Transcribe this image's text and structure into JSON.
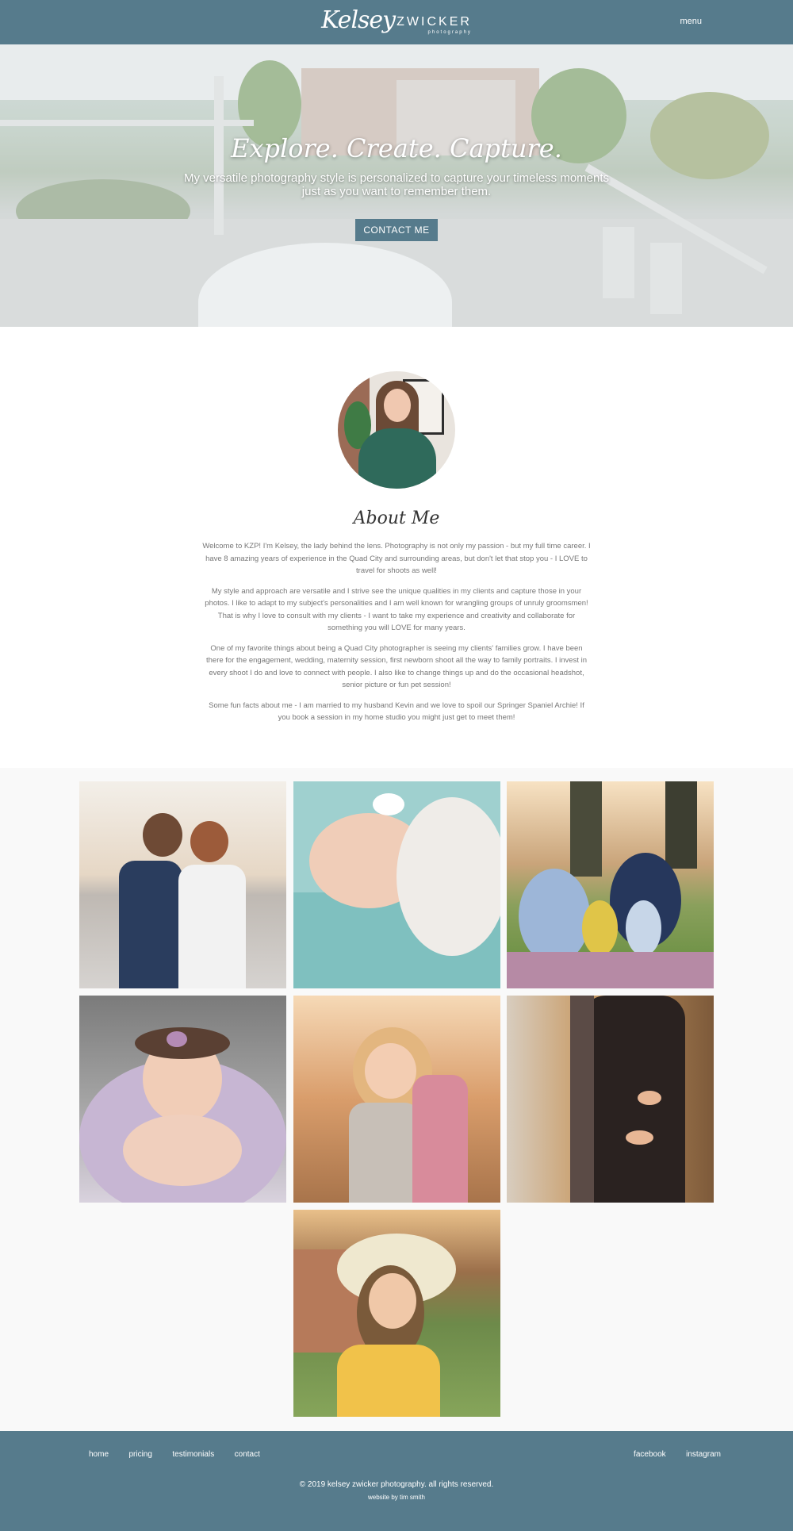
{
  "header": {
    "logo_script": "Kelsey",
    "logo_word": "ZWICKER",
    "logo_sub": "photography",
    "menu_label": "menu"
  },
  "hero": {
    "title": "Explore. Create. Capture.",
    "subtitle": "My versatile photography style is personalized to capture your timeless moments just as you want to remember them.",
    "cta_label": "CONTACT ME"
  },
  "about": {
    "title": "About Me",
    "paragraphs": [
      "Welcome to KZP! I'm Kelsey, the lady behind the lens. Photography is not only my passion - but my full time career. I have 8 amazing years of experience in the Quad City and surrounding areas, but don't let that stop you - I LOVE to travel for shoots as well!",
      "My style and approach are versatile and I strive see the unique qualities in my clients and capture those in your photos. I like to adapt to my subject's personalities and I am well known for wrangling groups of unruly groomsmen! That is why I love to consult with my clients - I want to take my experience and creativity and collaborate for something you will LOVE for many years.",
      "One of my favorite things about being a Quad City photographer is seeing my clients' families grow. I have been there for the engagement, wedding, maternity session, first newborn shoot all the way to family portraits. I invest in every shoot I do and love to connect with people. I also like to change things up and do the occasional headshot, senior picture or fun pet session!",
      "Some fun facts about me - I am married to my husband Kevin and we love to spoil our Springer Spaniel Archie! If you book a session in my home studio you might just get to meet them!"
    ]
  },
  "footer": {
    "nav": [
      "home",
      "pricing",
      "testimonials",
      "contact"
    ],
    "social": [
      "facebook",
      "instagram"
    ],
    "copyright": "© 2019 kelsey zwicker photography. all rights reserved.",
    "credit": "website by tim smith"
  },
  "colors": {
    "brand": "#567b8c",
    "gallery_bg": "#f9f9f9"
  }
}
